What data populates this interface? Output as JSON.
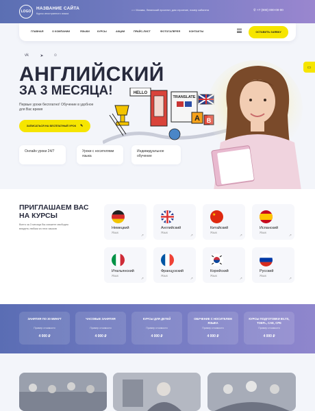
{
  "header": {
    "logo_text": "LOGO",
    "site_name": "НАЗВАНИЕ САЙТА",
    "site_sub": "Курсы иностранного языка",
    "address": "г. Москва, Ленинский проспект, дом строение, номер кабинета",
    "phone": "+7 (000) 000-00-00"
  },
  "nav": {
    "items": [
      "ГЛАВНАЯ",
      "О КОМПАНИИ",
      "ЯЗЫКИ",
      "КУРСЫ",
      "АКЦИИ",
      "ПРАЙС-ЛИСТ",
      "ФОТОГАЛЕРЕЯ",
      "КОНТАКТЫ"
    ],
    "cta": "ОСТАВИТЬ ЗАЯВКУ"
  },
  "social": [
    "vk-icon",
    "telegram-icon",
    "ok-icon"
  ],
  "hero": {
    "title": "АНГЛИЙСКИЙ",
    "subtitle": "ЗА 3 МЕСЯЦА!",
    "desc": "Первые уроки бесплатно! Обучение в удобное для Вас время",
    "button": "ЗАПИСАТЬСЯ НА БЕСПЛАТНЫЙ УРОК",
    "features": [
      "Онлайн уроки 24/7",
      "Уроки с носителями языка",
      "Индивидуальное обучение"
    ],
    "illus_words": [
      "HELLO",
      "TRANSLATE",
      "A",
      "B"
    ]
  },
  "courses": {
    "title": "ПРИГЛАШАЕМ ВАС НА КУРСЫ",
    "subtitle": "Всего за 3 месяца Вы сможете свободно владеть любым из этих языков",
    "langs": [
      {
        "name": "Немецкий",
        "label": "Язык"
      },
      {
        "name": "Английский",
        "label": "Язык"
      },
      {
        "name": "Китайский",
        "label": "Язык"
      },
      {
        "name": "Испанский",
        "label": "Язык"
      },
      {
        "name": "Итальянский",
        "label": "Язык"
      },
      {
        "name": "Французский",
        "label": "Язык"
      },
      {
        "name": "Корейский",
        "label": "Язык"
      },
      {
        "name": "Русский",
        "label": "Язык"
      }
    ]
  },
  "prices": [
    {
      "title": "ЗАНЯТИЯ ПО 30 МИНУТ",
      "note": "Пример стоимости",
      "price": "4 000 ₽"
    },
    {
      "title": "ЧАСОВЫЕ ЗАНЯТИЯ",
      "note": "Пример стоимости",
      "price": "4 000 ₽"
    },
    {
      "title": "КУРСЫ ДЛЯ ДЕТЕЙ",
      "note": "Пример стоимости",
      "price": "4 000 ₽"
    },
    {
      "title": "ОБУЧЕНИЕ С НОСИТЕЛЕМ ЯЗЫКА",
      "note": "Пример стоимости",
      "price": "4 000 ₽"
    },
    {
      "title": "КУРСЫ ПОДГОТОВКИ IELTS, TOEFL, CAE, CPE",
      "note": "Пример стоимости",
      "price": "4 000 ₽"
    }
  ],
  "colors": {
    "accent": "#f6e500",
    "brand": "#6a74bd",
    "text": "#272a3c"
  }
}
